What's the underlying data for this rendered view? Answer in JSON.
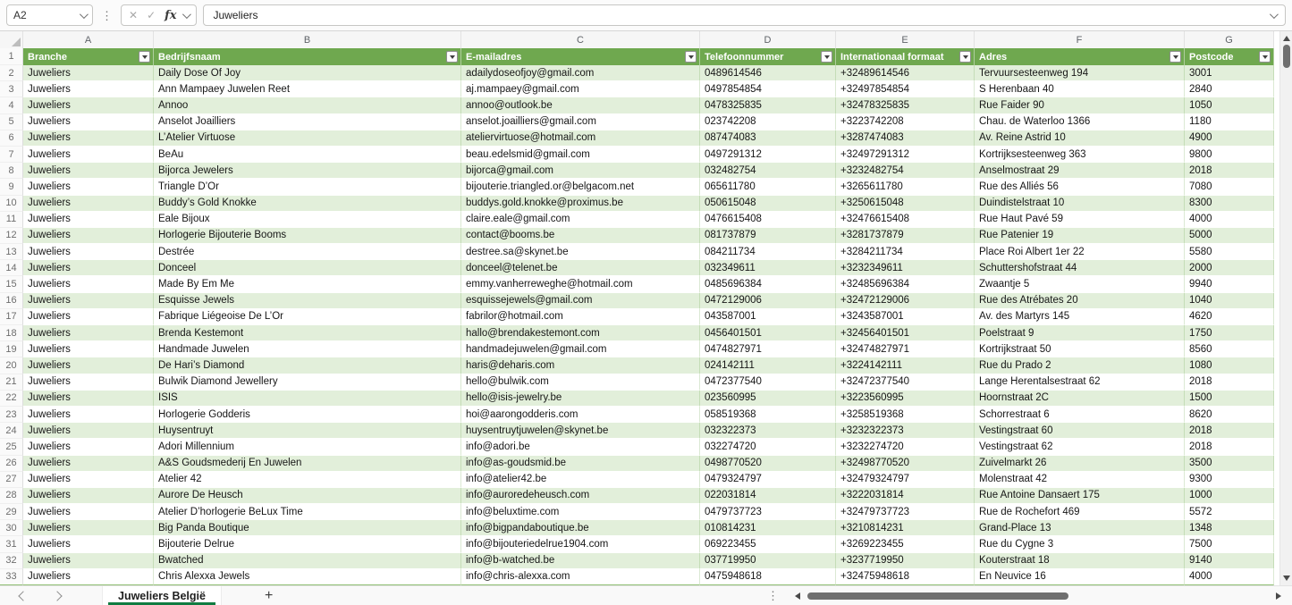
{
  "formula_bar": {
    "name_box_value": "A2",
    "formula_value": "Juweliers",
    "fx_label": "fx"
  },
  "icons": {
    "more_dots": "⋮",
    "cancel": "✕",
    "confirm": "✓",
    "plus": "+"
  },
  "colors": {
    "header_green": "#6FA84F",
    "band_green": "#E2EFDA",
    "tab_underline_green": "#107C41"
  },
  "columns": [
    {
      "letter": "A",
      "header": "Branche"
    },
    {
      "letter": "B",
      "header": "Bedrijfsnaam"
    },
    {
      "letter": "C",
      "header": "E-mailadres"
    },
    {
      "letter": "D",
      "header": "Telefoonnummer"
    },
    {
      "letter": "E",
      "header": "Internationaal formaat"
    },
    {
      "letter": "F",
      "header": "Adres"
    },
    {
      "letter": "G",
      "header": "Postcode"
    }
  ],
  "table": {
    "header_row_number": 1,
    "first_data_row_number": 2,
    "rows": [
      [
        "Juweliers",
        "Daily Dose Of Joy",
        "adailydoseofjoy@gmail.com",
        "0489614546",
        "+32489614546",
        "Tervuursesteenweg 194",
        "3001"
      ],
      [
        "Juweliers",
        "Ann Mampaey Juwelen Reet",
        "aj.mampaey@gmail.com",
        "0497854854",
        "+32497854854",
        "S Herenbaan 40",
        "2840"
      ],
      [
        "Juweliers",
        "Annoo",
        "annoo@outlook.be",
        "0478325835",
        "+32478325835",
        "Rue Faider 90",
        "1050"
      ],
      [
        "Juweliers",
        "Anselot Joailliers",
        "anselot.joailliers@gmail.com",
        "023742208",
        "+3223742208",
        "Chau. de Waterloo 1366",
        "1180"
      ],
      [
        "Juweliers",
        "L’Atelier Virtuose",
        "ateliervirtuose@hotmail.com",
        "087474083",
        "+3287474083",
        "Av. Reine Astrid 10",
        "4900"
      ],
      [
        "Juweliers",
        "BeAu",
        "beau.edelsmid@gmail.com",
        "0497291312",
        "+32497291312",
        "Kortrijksesteenweg 363",
        "9800"
      ],
      [
        "Juweliers",
        "Bijorca Jewelers",
        "bijorca@gmail.com",
        "032482754",
        "+3232482754",
        "Anselmostraat 29",
        "2018"
      ],
      [
        "Juweliers",
        "Triangle D’Or",
        "bijouterie.triangled.or@belgacom.net",
        "065611780",
        "+3265611780",
        "Rue des Alliés 56",
        "7080"
      ],
      [
        "Juweliers",
        "Buddy’s Gold Knokke",
        "buddys.gold.knokke@proximus.be",
        "050615048",
        "+3250615048",
        "Duindistelstraat 10",
        "8300"
      ],
      [
        "Juweliers",
        "Eale Bijoux",
        "claire.eale@gmail.com",
        "0476615408",
        "+32476615408",
        "Rue Haut Pavé 59",
        "4000"
      ],
      [
        "Juweliers",
        "Horlogerie Bijouterie Booms",
        "contact@booms.be",
        "081737879",
        "+3281737879",
        "Rue Patenier 19",
        "5000"
      ],
      [
        "Juweliers",
        "Destrée",
        "destree.sa@skynet.be",
        "084211734",
        "+3284211734",
        "Place Roi Albert 1er 22",
        "5580"
      ],
      [
        "Juweliers",
        "Donceel",
        "donceel@telenet.be",
        "032349611",
        "+3232349611",
        "Schuttershofstraat 44",
        "2000"
      ],
      [
        "Juweliers",
        "Made By Em Me",
        "emmy.vanherreweghe@hotmail.com",
        "0485696384",
        "+32485696384",
        "Zwaantje 5",
        "9940"
      ],
      [
        "Juweliers",
        "Esquisse Jewels",
        "esquissejewels@gmail.com",
        "0472129006",
        "+32472129006",
        "Rue des Atrébates 20",
        "1040"
      ],
      [
        "Juweliers",
        "Fabrique Liégeoise De L’Or",
        "fabrilor@hotmail.com",
        "043587001",
        "+3243587001",
        "Av. des Martyrs 145",
        "4620"
      ],
      [
        "Juweliers",
        "Brenda Kestemont",
        "hallo@brendakestemont.com",
        "0456401501",
        "+32456401501",
        "Poelstraat 9",
        "1750"
      ],
      [
        "Juweliers",
        "Handmade Juwelen",
        "handmadejuwelen@gmail.com",
        "0474827971",
        "+32474827971",
        "Kortrijkstraat 50",
        "8560"
      ],
      [
        "Juweliers",
        "De Hari’s Diamond",
        "haris@deharis.com",
        "024142111",
        "+3224142111",
        "Rue du Prado 2",
        "1080"
      ],
      [
        "Juweliers",
        "Bulwik Diamond Jewellery",
        "hello@bulwik.com",
        "0472377540",
        "+32472377540",
        "Lange Herentalsestraat 62",
        "2018"
      ],
      [
        "Juweliers",
        "ISIS",
        "hello@isis-jewelry.be",
        "023560995",
        "+3223560995",
        "Hoornstraat 2C",
        "1500"
      ],
      [
        "Juweliers",
        "Horlogerie Godderis",
        "hoi@aarongodderis.com",
        "058519368",
        "+3258519368",
        "Schorrestraat 6",
        "8620"
      ],
      [
        "Juweliers",
        "Huysentruyt",
        "huysentruytjuwelen@skynet.be",
        "032322373",
        "+3232322373",
        "Vestingstraat 60",
        "2018"
      ],
      [
        "Juweliers",
        "Adori Millennium",
        "info@adori.be",
        "032274720",
        "+3232274720",
        "Vestingstraat 62",
        "2018"
      ],
      [
        "Juweliers",
        "A&S Goudsmederij En Juwelen",
        "info@as-goudsmid.be",
        "0498770520",
        "+32498770520",
        "Zuivelmarkt 26",
        "3500"
      ],
      [
        "Juweliers",
        "Atelier 42",
        "info@atelier42.be",
        "0479324797",
        "+32479324797",
        "Molenstraat 42",
        "9300"
      ],
      [
        "Juweliers",
        "Aurore De Heusch",
        "info@auroredeheusch.com",
        "022031814",
        "+3222031814",
        "Rue Antoine Dansaert 175",
        "1000"
      ],
      [
        "Juweliers",
        "Atelier D’horlogerie BeLux Time",
        "info@beluxtime.com",
        "0479737723",
        "+32479737723",
        "Rue de Rochefort 469",
        "5572"
      ],
      [
        "Juweliers",
        "Big Panda Boutique",
        "info@bigpandaboutique.be",
        "010814231",
        "+3210814231",
        "Grand-Place 13",
        "1348"
      ],
      [
        "Juweliers",
        "Bijouterie Delrue",
        "info@bijouteriedelrue1904.com",
        "069223455",
        "+3269223455",
        "Rue du Cygne 3",
        "7500"
      ],
      [
        "Juweliers",
        "Bwatched",
        "info@b-watched.be",
        "037719950",
        "+3237719950",
        "Kouterstraat 18",
        "9140"
      ],
      [
        "Juweliers",
        "Chris Alexxa Jewels",
        "info@chris-alexxa.com",
        "0475948618",
        "+32475948618",
        "En Neuvice 16",
        "4000"
      ]
    ]
  },
  "sheet_bar": {
    "tab_name": "Juweliers België"
  }
}
